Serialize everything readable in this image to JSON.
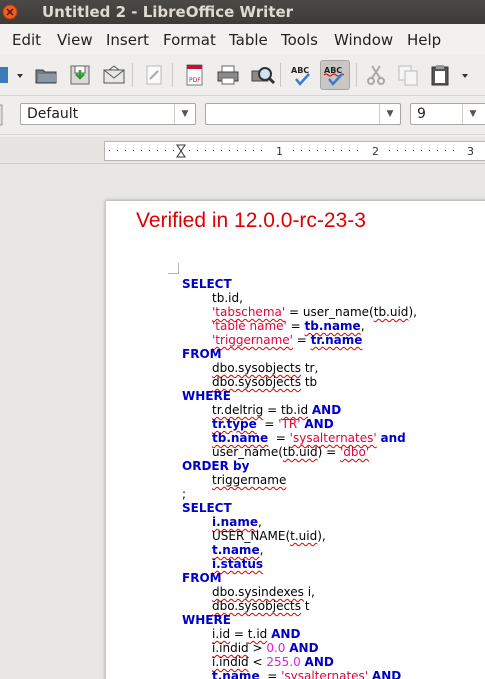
{
  "window": {
    "title": "Untitled 2 - LibreOffice Writer"
  },
  "menubar": {
    "items": [
      "Edit",
      "View",
      "Insert",
      "Format",
      "Table",
      "Tools",
      "Window",
      "Help"
    ]
  },
  "formatting": {
    "paragraph_style": "Default",
    "font_name": "",
    "font_size": "9"
  },
  "ruler": {
    "marks": [
      "1",
      "2",
      "3"
    ]
  },
  "document": {
    "heading": "Verified in 12.0.0-rc-23-3",
    "code_lines": [
      [
        {
          "t": "SELECT",
          "c": "kw"
        }
      ],
      [
        {
          "t": "tb.id,"
        }
      ],
      [
        {
          "t": "'tabschema'",
          "c": "str sq"
        },
        {
          "t": " = user_name("
        },
        {
          "t": "tb.uid",
          "c": "sq"
        },
        {
          "t": "),"
        }
      ],
      [
        {
          "t": "'table name'",
          "c": "str"
        },
        {
          "t": " = "
        },
        {
          "t": "tb.name",
          "c": "kw sq"
        },
        {
          "t": ","
        }
      ],
      [
        {
          "t": "'triggername'",
          "c": "str sq"
        },
        {
          "t": " = "
        },
        {
          "t": "tr.name",
          "c": "kw sq"
        }
      ],
      [
        {
          "t": "FROM",
          "c": "kw"
        }
      ],
      [
        {
          "t": "dbo.sysobjects",
          "c": "sq"
        },
        {
          "t": " tr,"
        }
      ],
      [
        {
          "t": "dbo.sysobjects",
          "c": "sq"
        },
        {
          "t": " tb"
        }
      ],
      [
        {
          "t": "WHERE",
          "c": "kw"
        }
      ],
      [
        {
          "t": "tr.deltrig",
          "c": "sq"
        },
        {
          "t": " = "
        },
        {
          "t": "tb.id",
          "c": "sq"
        },
        {
          "t": " "
        },
        {
          "t": "AND",
          "c": "kw"
        }
      ],
      [
        {
          "t": "tr.type",
          "c": "kw sq"
        },
        {
          "t": "  = "
        },
        {
          "t": "'TR'",
          "c": "str"
        },
        {
          "t": " "
        },
        {
          "t": "AND",
          "c": "kw"
        }
      ],
      [
        {
          "t": "tb.name",
          "c": "kw sq"
        },
        {
          "t": "  = "
        },
        {
          "t": "'sysalternates'",
          "c": "str sq"
        },
        {
          "t": " "
        },
        {
          "t": "and",
          "c": "kw"
        }
      ],
      [
        {
          "t": "user_name("
        },
        {
          "t": "tb.uid",
          "c": "sq"
        },
        {
          "t": ") = "
        },
        {
          "t": "'dbo'",
          "c": "str sq"
        }
      ],
      [
        {
          "t": "ORDER by",
          "c": "kw"
        }
      ],
      [
        {
          "t": "triggername",
          "c": "sq"
        }
      ],
      [
        {
          "t": ";"
        }
      ],
      [
        {
          "t": "SELECT",
          "c": "kw"
        }
      ],
      [
        {
          "t": "i.name",
          "c": "kw sq"
        },
        {
          "t": ","
        }
      ],
      [
        {
          "t": "USER_NAME("
        },
        {
          "t": "t.uid",
          "c": "sq"
        },
        {
          "t": "),"
        }
      ],
      [
        {
          "t": "t.name",
          "c": "kw sq"
        },
        {
          "t": ","
        }
      ],
      [
        {
          "t": "i.status",
          "c": "kw sq"
        }
      ],
      [
        {
          "t": "FROM",
          "c": "kw"
        }
      ],
      [
        {
          "t": "dbo.sysindexes",
          "c": "sq"
        },
        {
          "t": " i,"
        }
      ],
      [
        {
          "t": "dbo.sysobjects",
          "c": "sq"
        },
        {
          "t": " t"
        }
      ],
      [
        {
          "t": "WHERE",
          "c": "kw"
        }
      ],
      [
        {
          "t": "i.id",
          "c": "sq"
        },
        {
          "t": " = "
        },
        {
          "t": "t.id",
          "c": "sq"
        },
        {
          "t": " "
        },
        {
          "t": "AND",
          "c": "kw"
        }
      ],
      [
        {
          "t": "i.indid",
          "c": "sq"
        },
        {
          "t": " > "
        },
        {
          "t": "0.0",
          "c": "num"
        },
        {
          "t": " "
        },
        {
          "t": "AND",
          "c": "kw"
        }
      ],
      [
        {
          "t": "i.indid",
          "c": "sq"
        },
        {
          "t": " < "
        },
        {
          "t": "255.0",
          "c": "num"
        },
        {
          "t": " "
        },
        {
          "t": "AND",
          "c": "kw"
        }
      ],
      [
        {
          "t": "t.name",
          "c": "kw sq"
        },
        {
          "t": "  = "
        },
        {
          "t": "'sysalternates'",
          "c": "str sq"
        },
        {
          "t": " "
        },
        {
          "t": "AND",
          "c": "kw"
        }
      ]
    ],
    "indent": [
      0,
      1,
      1,
      1,
      1,
      0,
      1,
      1,
      0,
      1,
      1,
      1,
      1,
      0,
      1,
      0,
      0,
      1,
      1,
      1,
      1,
      0,
      1,
      1,
      0,
      1,
      1,
      1,
      1
    ]
  },
  "icons": {
    "toolbar": [
      "format-toolbar-icon",
      "open-icon",
      "save-icon",
      "email-icon",
      "edit-file-icon",
      "export-pdf-icon",
      "print-icon",
      "print-preview-icon",
      "spelling-icon",
      "autospellcheck-icon",
      "cut-icon",
      "copy-icon",
      "paste-icon",
      "paste-menu-icon"
    ]
  },
  "colors": {
    "heading": "#e00000",
    "keyword": "#0000c8",
    "string": "#e8003a",
    "number": "#e020e0",
    "titlebar": "#3c3b37"
  }
}
